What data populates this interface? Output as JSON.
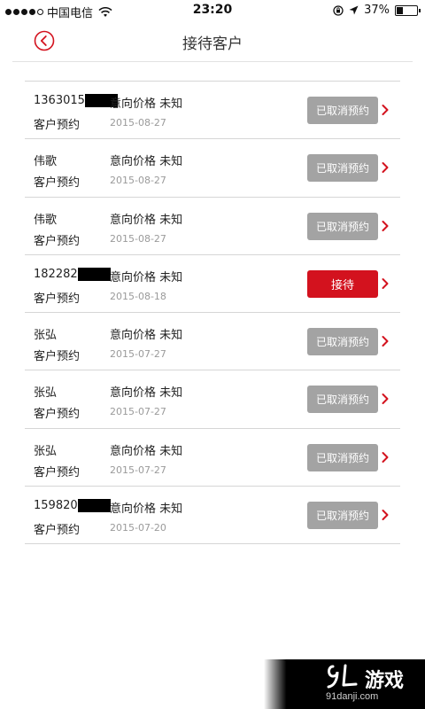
{
  "status_bar": {
    "carrier": "中国电信",
    "time": "23:20",
    "battery_text": "37%",
    "battery_level": 0.37
  },
  "nav": {
    "title": "接待客户",
    "back_icon": "back-arrow-circle-icon"
  },
  "colors": {
    "accent": "#d3121e",
    "cancelled_gray": "#a3a3a3",
    "divider": "#d6d6d6"
  },
  "items": [
    {
      "name": "1363015",
      "redacted": true,
      "type": "客户预约",
      "intent": "意向价格 未知",
      "date": "2015-08-27",
      "status": "已取消预约",
      "active": false
    },
    {
      "name": "伟歌",
      "redacted": false,
      "type": "客户预约",
      "intent": "意向价格 未知",
      "date": "2015-08-27",
      "status": "已取消预约",
      "active": false
    },
    {
      "name": "伟歌",
      "redacted": false,
      "type": "客户预约",
      "intent": "意向价格 未知",
      "date": "2015-08-27",
      "status": "已取消预约",
      "active": false
    },
    {
      "name": "182282",
      "redacted": true,
      "type": "客户预约",
      "intent": "意向价格 未知",
      "date": "2015-08-18",
      "status": "接待",
      "active": true
    },
    {
      "name": "张弘",
      "redacted": false,
      "type": "客户预约",
      "intent": "意向价格 未知",
      "date": "2015-07-27",
      "status": "已取消预约",
      "active": false
    },
    {
      "name": "张弘",
      "redacted": false,
      "type": "客户预约",
      "intent": "意向价格 未知",
      "date": "2015-07-27",
      "status": "已取消预约",
      "active": false
    },
    {
      "name": "张弘",
      "redacted": false,
      "type": "客户预约",
      "intent": "意向价格 未知",
      "date": "2015-07-27",
      "status": "已取消预约",
      "active": false
    },
    {
      "name": "159820",
      "redacted": true,
      "type": "客户预约",
      "intent": "意向价格 未知",
      "date": "2015-07-20",
      "status": "已取消预约",
      "active": false
    }
  ],
  "watermark": {
    "text": "游戏",
    "sub": "91danji.com"
  }
}
